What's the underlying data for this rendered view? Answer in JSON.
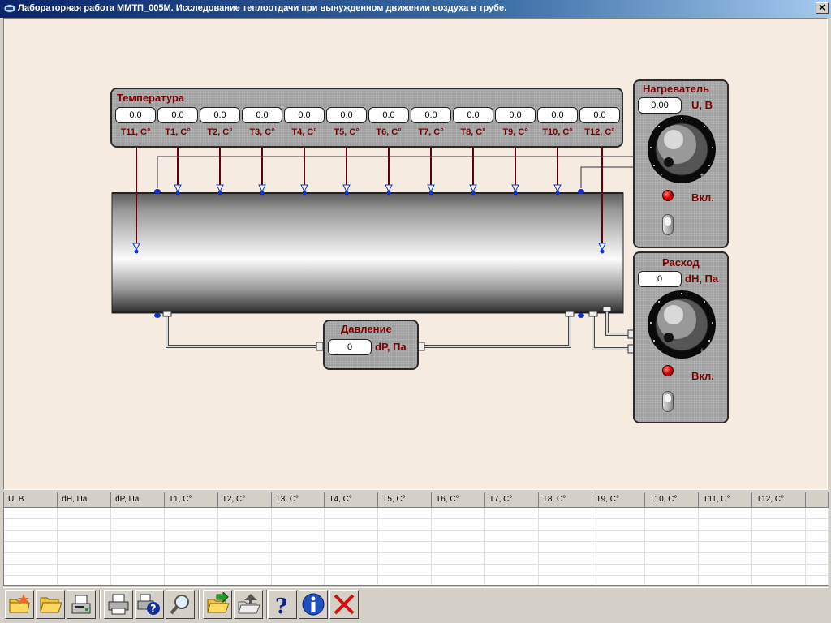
{
  "window": {
    "title": "Лабораторная работа ММТП_005М. Исследование теплоотдачи при вынужденном движении воздуха в трубе.",
    "close_label": "×"
  },
  "temperature_panel": {
    "title": "Температура",
    "sensors": [
      {
        "value": "0.0",
        "label": "T11, С°"
      },
      {
        "value": "0.0",
        "label": "T1, С°"
      },
      {
        "value": "0.0",
        "label": "T2, С°"
      },
      {
        "value": "0.0",
        "label": "T3, С°"
      },
      {
        "value": "0.0",
        "label": "T4, С°"
      },
      {
        "value": "0.0",
        "label": "T5, С°"
      },
      {
        "value": "0.0",
        "label": "T6, С°"
      },
      {
        "value": "0.0",
        "label": "T7, С°"
      },
      {
        "value": "0.0",
        "label": "T8, С°"
      },
      {
        "value": "0.0",
        "label": "T9, С°"
      },
      {
        "value": "0.0",
        "label": "T10, С°"
      },
      {
        "value": "0.0",
        "label": "T12, С°"
      }
    ]
  },
  "heater_panel": {
    "title": "Нагреватель",
    "value": "0.00",
    "unit": "U, В",
    "switch_label": "Вкл."
  },
  "flow_panel": {
    "title": "Расход",
    "value": "0",
    "unit": "dH, Па",
    "switch_label": "Вкл."
  },
  "pressure_panel": {
    "title": "Давление",
    "value": "0",
    "unit": "dP, Па"
  },
  "table": {
    "columns": [
      "U, В",
      "dH, Па",
      "dP, Па",
      "T1, С°",
      "T2, С°",
      "T3, С°",
      "T4, С°",
      "T5, С°",
      "T6, С°",
      "T7, С°",
      "T8, С°",
      "T9, С°",
      "T10, С°",
      "T11, С°",
      "T12, С°"
    ],
    "rows": []
  },
  "toolbar": {
    "buttons": [
      {
        "name": "new-file-button",
        "icon": "new-folder-icon"
      },
      {
        "name": "open-file-button",
        "icon": "open-folder-icon"
      },
      {
        "name": "save-button",
        "icon": "save-drive-icon"
      },
      {
        "name": "print-button",
        "icon": "printer-icon"
      },
      {
        "name": "print-help-button",
        "icon": "printer-help-icon"
      },
      {
        "name": "preview-button",
        "icon": "magnifier-icon"
      },
      {
        "name": "export-button",
        "icon": "export-folder-icon"
      },
      {
        "name": "import-button",
        "icon": "import-folder-icon"
      },
      {
        "name": "help-button",
        "icon": "question-icon"
      },
      {
        "name": "info-button",
        "icon": "info-icon"
      },
      {
        "name": "exit-button",
        "icon": "red-cross-icon"
      }
    ]
  }
}
